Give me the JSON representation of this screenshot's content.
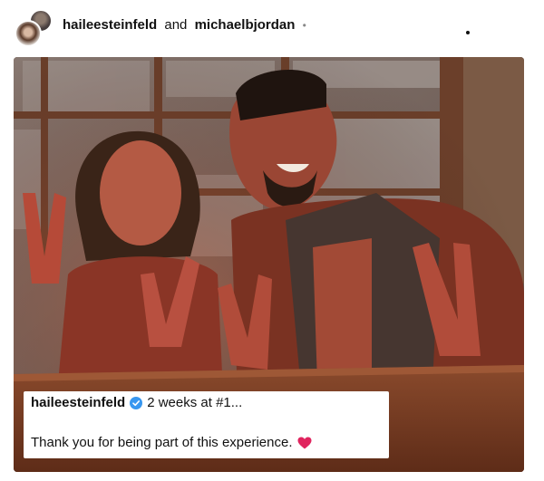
{
  "header": {
    "user1": "haileesteinfeld",
    "connector": "and",
    "user2": "michaelbjordan",
    "separator": "•"
  },
  "caption": {
    "username": "haileesteinfeld",
    "line1_text": "2 weeks at #1...",
    "line2_text": "Thank you for being part of this experience."
  },
  "colors": {
    "verified": "#3897f0",
    "heart": "#e0245e"
  }
}
